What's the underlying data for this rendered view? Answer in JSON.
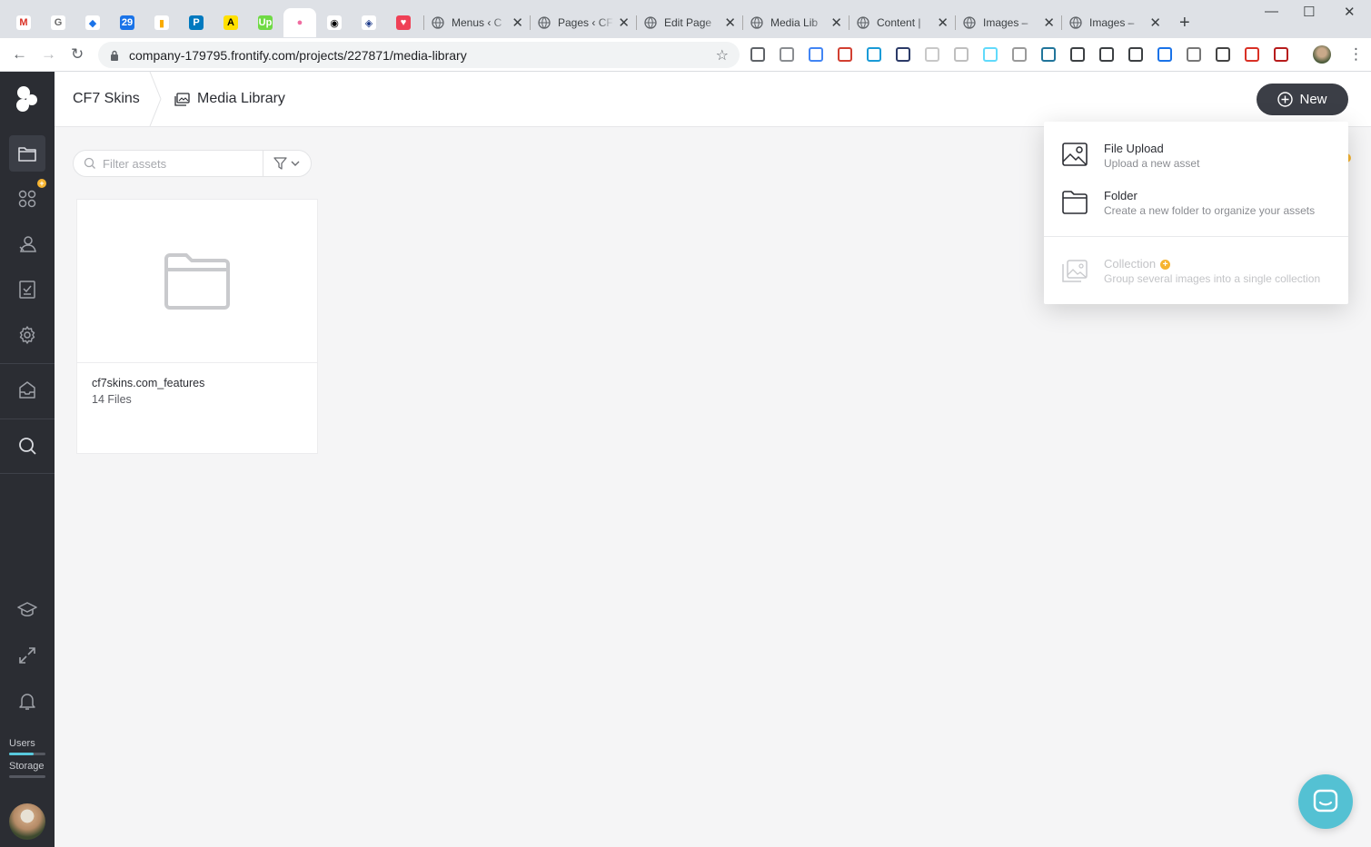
{
  "browser": {
    "pinned_tabs": [
      {
        "name": "gmail-tab-icon",
        "glyph": "M",
        "color": "#ffffff",
        "fg": "#d93025"
      },
      {
        "name": "reload-app-tab-icon",
        "glyph": "G",
        "color": "#ffffff",
        "fg": "#6b6b6b"
      },
      {
        "name": "drive-tab-icon",
        "glyph": "◆",
        "color": "#ffffff",
        "fg": "#1a73e8"
      },
      {
        "name": "calendar-tab-icon",
        "glyph": "29",
        "color": "#1a73e8",
        "fg": "#ffffff"
      },
      {
        "name": "analytics-tab-icon",
        "glyph": "▮",
        "color": "#ffffff",
        "fg": "#f9ab00"
      },
      {
        "name": "trello-tab-icon",
        "glyph": "P",
        "color": "#0079bf",
        "fg": "#ffffff"
      },
      {
        "name": "ahrefs-tab-icon",
        "glyph": "A",
        "color": "#ffe000",
        "fg": "#000000"
      },
      {
        "name": "upwork-tab-icon",
        "glyph": "Up",
        "color": "#6fda44",
        "fg": "#ffffff"
      },
      {
        "name": "frontify-tab-icon",
        "glyph": "●",
        "color": "#ffffff",
        "fg": "#f06ca0"
      },
      {
        "name": "circle-app-tab-icon",
        "glyph": "◉",
        "color": "#ffffff",
        "fg": "#000000"
      },
      {
        "name": "globe-app-tab-icon",
        "glyph": "◈",
        "color": "#ffffff",
        "fg": "#1b3a8a"
      },
      {
        "name": "pocket-tab-icon",
        "glyph": "♥",
        "color": "#ef4056",
        "fg": "#ffffff"
      }
    ],
    "tabs": [
      {
        "label": "Menus ‹ C"
      },
      {
        "label": "Pages ‹ CF"
      },
      {
        "label": "Edit Page"
      },
      {
        "label": "Media Lib"
      },
      {
        "label": "Content |"
      },
      {
        "label": "Images – "
      },
      {
        "label": "Images – "
      }
    ],
    "url": "company-179795.frontify.com/projects/227871/media-library"
  },
  "sidebar": {
    "items": [
      {
        "name": "media-library-nav",
        "icon": "folder-icon"
      },
      {
        "name": "apps-nav",
        "icon": "apps-icon"
      },
      {
        "name": "users-nav",
        "icon": "users-icon"
      },
      {
        "name": "tasks-nav",
        "icon": "checklist-icon"
      },
      {
        "name": "settings-nav",
        "icon": "gear-icon"
      },
      {
        "name": "inbox-nav",
        "icon": "inbox-icon"
      },
      {
        "name": "search-nav",
        "icon": "search-icon"
      },
      {
        "name": "academy-nav",
        "icon": "graduation-cap-icon"
      },
      {
        "name": "fullscreen-nav",
        "icon": "expand-icon"
      },
      {
        "name": "notifications-nav",
        "icon": "bell-icon"
      }
    ],
    "users_label": "Users",
    "storage_label": "Storage",
    "users_quota": 0.68,
    "storage_quota": 0.0
  },
  "header": {
    "project": "CF7 Skins",
    "section": "Media Library",
    "new_label": "New"
  },
  "filter": {
    "placeholder": "Filter assets"
  },
  "folder": {
    "name": "cf7skins.com_features",
    "count": "14 Files"
  },
  "new_menu": {
    "file_upload": {
      "title": "File Upload",
      "desc": "Upload a new asset"
    },
    "folder": {
      "title": "Folder",
      "desc": "Create a new folder to organize your assets"
    },
    "collection": {
      "title": "Collection",
      "desc": "Group several images into a single collection"
    },
    "pro_badge": "+"
  },
  "colors": {
    "sidebar_bg": "#2b2d33",
    "accent_teal": "#54c1d3",
    "badge_orange": "#f6b431",
    "button_dark": "#3b3e46"
  }
}
